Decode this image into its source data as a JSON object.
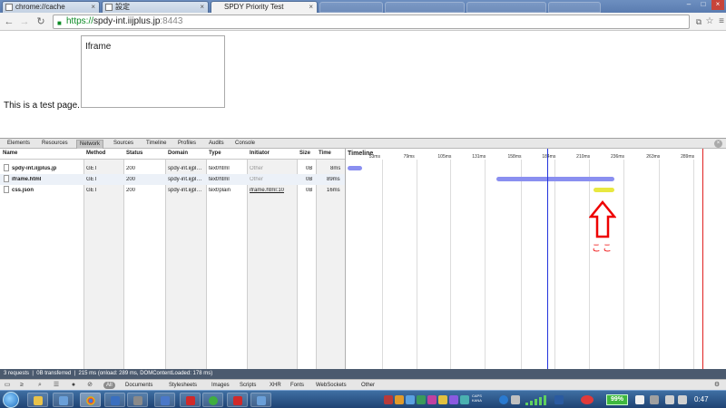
{
  "tabs": [
    {
      "label": "chrome://cache",
      "active": false
    },
    {
      "label": "設定",
      "active": false
    },
    {
      "label": "SPDY Priority Test",
      "active": true
    }
  ],
  "omnibox": {
    "scheme": "https://",
    "host": "spdy-int.iijplus.jp",
    "port": ":8443"
  },
  "page": {
    "text": "This is a test page.",
    "iframe_label": "Iframe"
  },
  "devtools": {
    "tabs": [
      "Elements",
      "Resources",
      "Network",
      "Sources",
      "Timeline",
      "Profiles",
      "Audits",
      "Console"
    ],
    "selected_tab": "Network",
    "columns": [
      "Name",
      "Method",
      "Status",
      "Domain",
      "Type",
      "Initiator",
      "Size",
      "Time"
    ],
    "timeline_label": "Timeline",
    "ticks": [
      "53ms",
      "79ms",
      "105ms",
      "131ms",
      "158ms",
      "184ms",
      "210ms",
      "236ms",
      "263ms",
      "289ms"
    ],
    "rows": [
      {
        "name": "spdy-int.iijplus.jp",
        "method": "GET",
        "status": "200",
        "domain": "spdy-int.iijpl…",
        "type": "text/html",
        "initiator": "Other",
        "size": "0B",
        "time": "8ms",
        "bar_start_ms": 27,
        "bar_end_ms": 38,
        "bar_color": "#8a8ff0"
      },
      {
        "name": "iframe.html",
        "method": "GET",
        "status": "200",
        "domain": "spdy-int.iijpl…",
        "type": "text/html",
        "initiator": "Other",
        "size": "0B",
        "time": "89ms",
        "bar_start_ms": 140,
        "bar_end_ms": 229,
        "bar_color": "#8a8ff0"
      },
      {
        "name": "css.json",
        "method": "GET",
        "status": "200",
        "domain": "spdy-int.iijpl…",
        "type": "text/plain",
        "initiator": "iframe.html:10",
        "size": "0B",
        "time": "16ms",
        "bar_start_ms": 213,
        "bar_end_ms": 229,
        "bar_color": "#e8e840"
      }
    ],
    "dom_content_loaded_ms": 178,
    "onload_ms": 289,
    "annotation": "ここ",
    "summary": "3 requests  |  0B transferred  |  215 ms (onload: 289 ms, DOMContentLoaded: 178 ms)",
    "filters": [
      "All",
      "Documents",
      "Stylesheets",
      "Images",
      "Scripts",
      "XHR",
      "Fonts",
      "WebSockets",
      "Other"
    ],
    "selected_filter": "All"
  },
  "taskbar": {
    "battery": "99%",
    "clock": "0:47",
    "tray_text": "CAPS\nKANA"
  }
}
